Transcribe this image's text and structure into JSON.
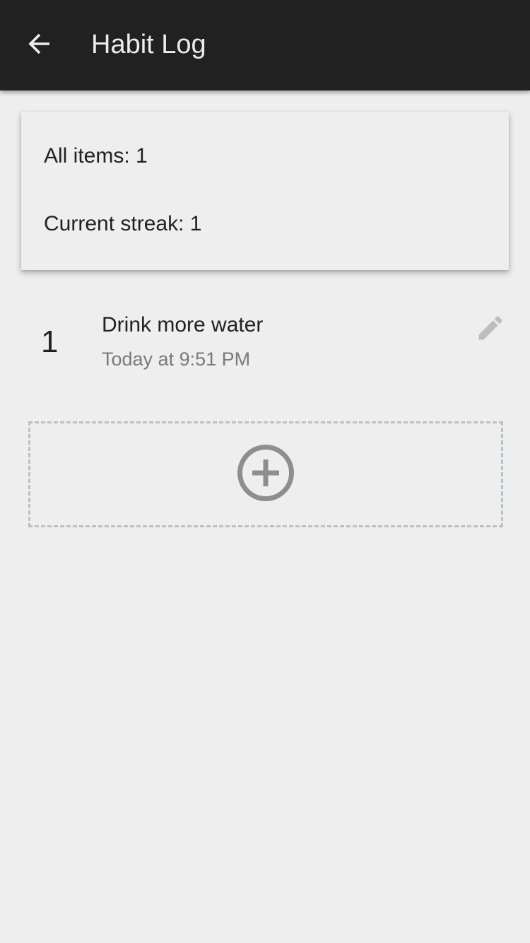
{
  "appbar": {
    "title": "Habit Log",
    "back_icon": "arrow-back-icon"
  },
  "stats": {
    "all_items": "All items: 1",
    "current_streak": "Current streak: 1"
  },
  "entries": [
    {
      "number": "1",
      "title": "Drink more water",
      "time": "Today at 9:51 PM",
      "edit_icon": "pencil-icon"
    }
  ],
  "add": {
    "icon": "plus-circle-icon"
  },
  "colors": {
    "appbar_bg": "#212121",
    "background": "#eeeeee",
    "icon_gray": "#8e8e8e",
    "dashed_border": "#b8c2c6"
  }
}
